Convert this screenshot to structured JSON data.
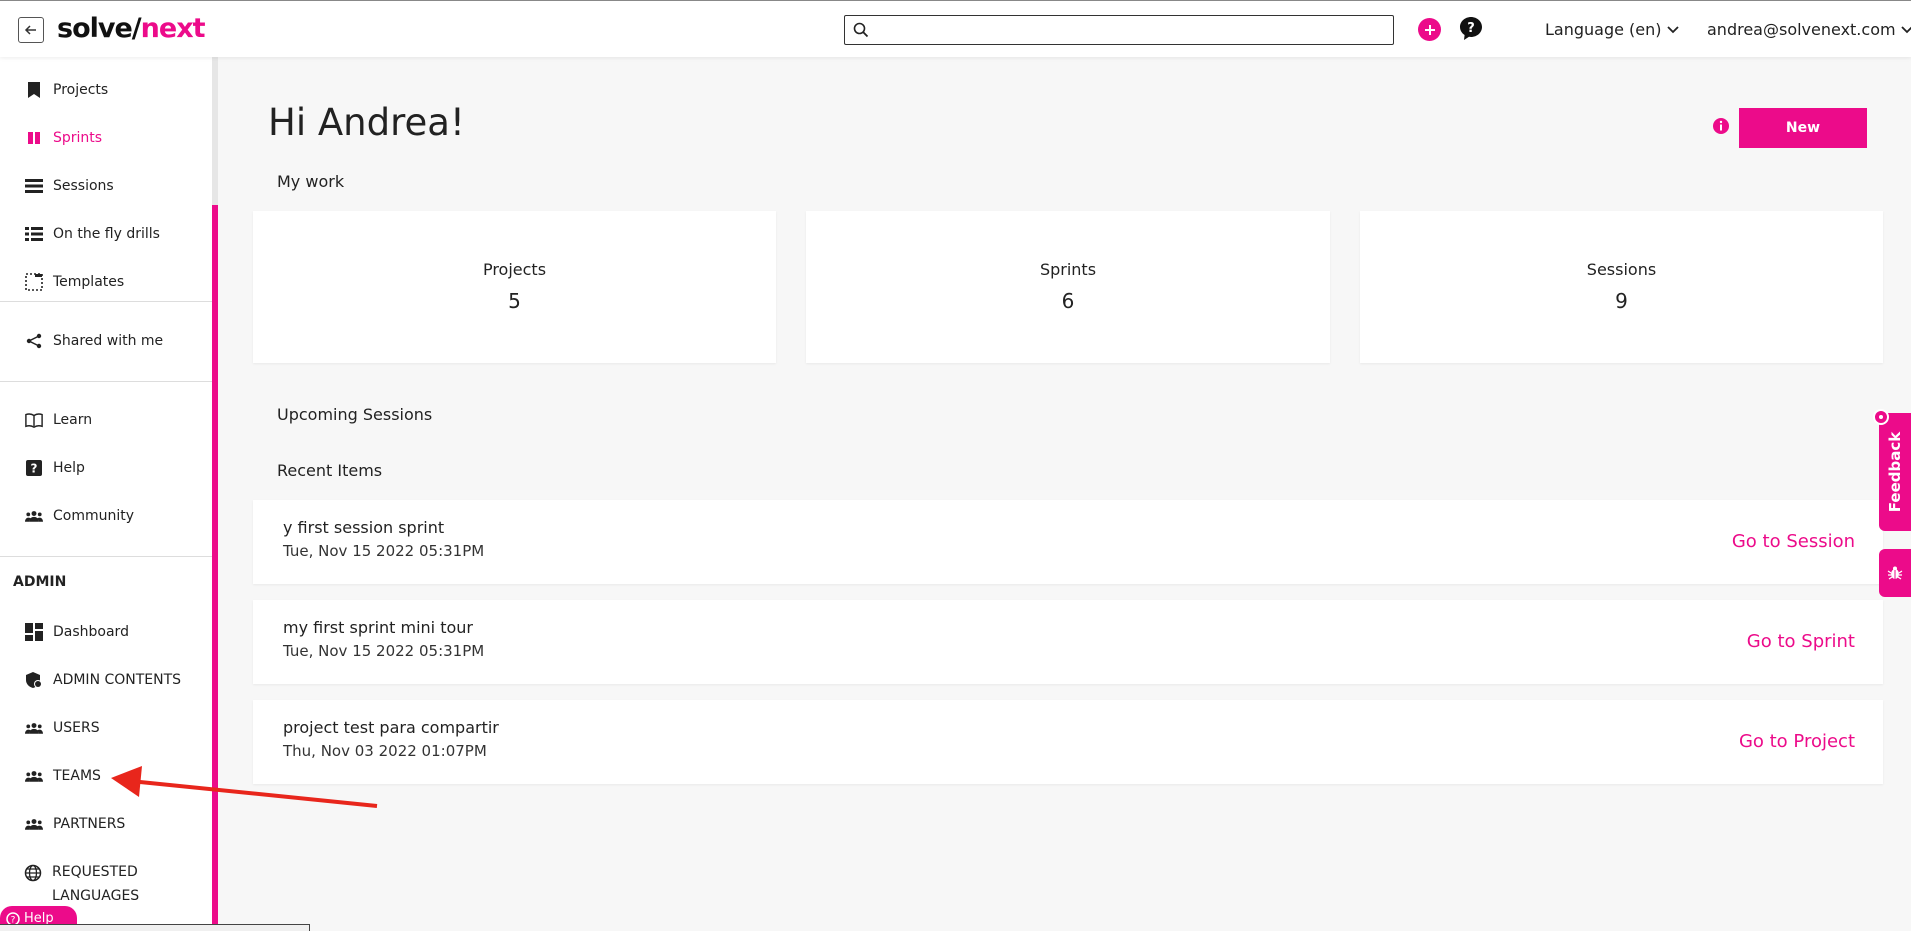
{
  "app": {
    "logo_part1": "solve",
    "logo_slash": "/",
    "logo_part2": "next",
    "search_placeholder": "",
    "language_label": "Language (en)",
    "user_email": "andrea@solvenext.com"
  },
  "sidebar": {
    "items": [
      {
        "label": "Projects",
        "icon": "bookmark-icon"
      },
      {
        "label": "Sprints",
        "icon": "sprint-icon",
        "active": true
      },
      {
        "label": "Sessions",
        "icon": "list-icon"
      },
      {
        "label": "On the fly drills",
        "icon": "list-bullet-icon"
      },
      {
        "label": "Templates",
        "icon": "template-icon"
      },
      {
        "label": "Shared with me",
        "icon": "share-icon"
      },
      {
        "label": "Learn",
        "icon": "book-icon"
      },
      {
        "label": "Help",
        "icon": "question-icon"
      },
      {
        "label": "Community",
        "icon": "group-icon"
      }
    ],
    "admin_heading": "ADMIN",
    "admin_items": [
      {
        "label": "Dashboard",
        "icon": "dashboard-icon"
      },
      {
        "label": "ADMIN CONTENTS",
        "icon": "shield-icon"
      },
      {
        "label": "USERS",
        "icon": "group-icon"
      },
      {
        "label": "TEAMS",
        "icon": "group-icon"
      },
      {
        "label": "PARTNERS",
        "icon": "group-icon"
      },
      {
        "label": "REQUESTED LANGUAGES",
        "icon": "globe-icon"
      }
    ],
    "help_pill": "Help"
  },
  "main": {
    "greeting": "Hi Andrea!",
    "new_button": "New",
    "my_work_label": "My work",
    "stats": [
      {
        "label": "Projects",
        "value": "5"
      },
      {
        "label": "Sprints",
        "value": "6"
      },
      {
        "label": "Sessions",
        "value": "9"
      }
    ],
    "upcoming_label": "Upcoming Sessions",
    "recent_label": "Recent Items",
    "recent_items": [
      {
        "title": "y first session sprint",
        "date": "Tue, Nov 15 2022 05:31PM",
        "action": "Go to Session"
      },
      {
        "title": "my first sprint mini tour",
        "date": "Tue, Nov 15 2022 05:31PM",
        "action": "Go to Sprint"
      },
      {
        "title": "project test para compartir",
        "date": "Thu, Nov 03 2022 01:07PM",
        "action": "Go to Project"
      }
    ]
  },
  "feedback_label": "Feedback",
  "colors": {
    "accent": "#ec0b8a",
    "annotation_arrow": "#e8261c"
  }
}
